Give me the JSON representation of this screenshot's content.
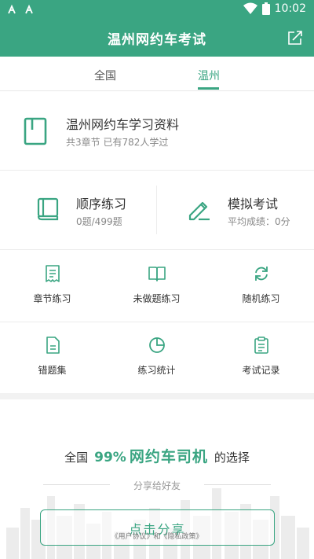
{
  "status_bar": {
    "time": "10:02"
  },
  "header": {
    "title": "温州网约车考试"
  },
  "tabs": [
    {
      "label": "全国"
    },
    {
      "label": "温州"
    }
  ],
  "material": {
    "title": "温州网约车学习资料",
    "subtitle": "共3章节  已有782人学过"
  },
  "practice": {
    "sequential": {
      "title": "顺序练习",
      "sub": "0题/499题"
    },
    "mock": {
      "title": "模拟考试",
      "sub": "平均成绩：0分"
    }
  },
  "grid": [
    {
      "label": "章节练习",
      "icon": "receipt-icon"
    },
    {
      "label": "未做题练习",
      "icon": "open-book-icon"
    },
    {
      "label": "随机练习",
      "icon": "refresh-icon"
    },
    {
      "label": "错题集",
      "icon": "document-icon"
    },
    {
      "label": "练习统计",
      "icon": "pie-chart-icon"
    },
    {
      "label": "考试记录",
      "icon": "clipboard-icon"
    }
  ],
  "promo": {
    "prefix": "全国",
    "percent": "99%",
    "brand": "网约车司机",
    "suffix": "的选择",
    "share_caption": "分享给好友",
    "share_button": "点击分享",
    "policy": "《用户协议》和《隐私政策》"
  },
  "colors": {
    "brand": "#3aa582",
    "text": "#333333",
    "muted": "#888888"
  }
}
